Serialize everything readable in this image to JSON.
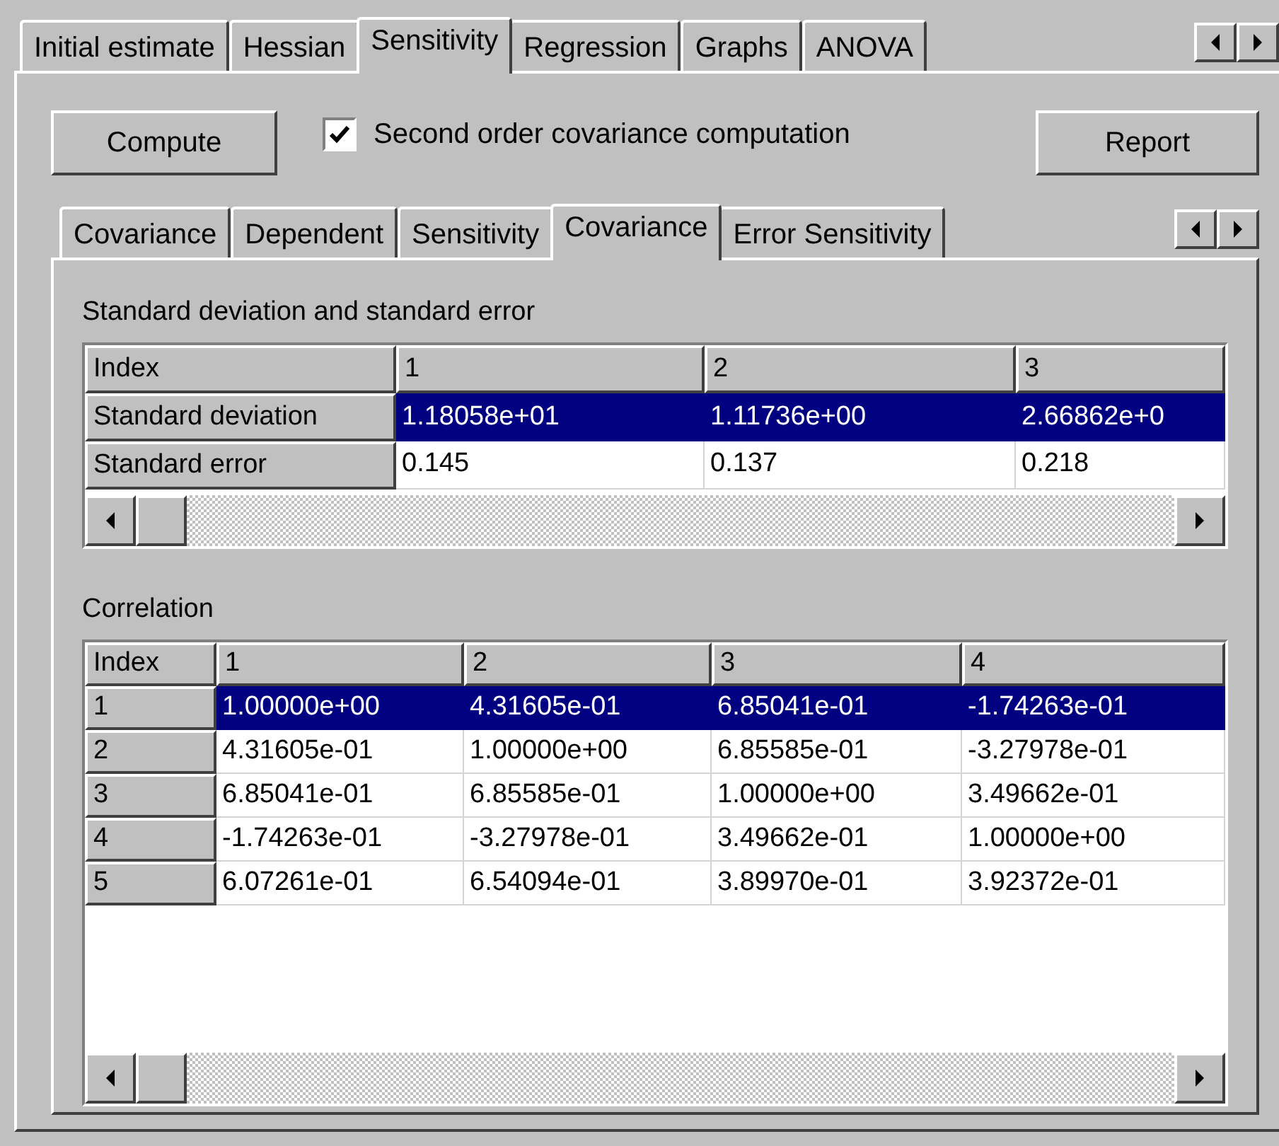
{
  "outer_tabs": [
    {
      "label": "Initial estimate",
      "selected": false
    },
    {
      "label": "Hessian",
      "selected": false
    },
    {
      "label": "Sensitivity",
      "selected": true
    },
    {
      "label": "Regression",
      "selected": false
    },
    {
      "label": "Graphs",
      "selected": false
    },
    {
      "label": "ANOVA",
      "selected": false
    }
  ],
  "compute_button": "Compute",
  "second_order": {
    "label": "Second order covariance computation",
    "checked": true
  },
  "report_button": "Report",
  "inner_tabs": [
    {
      "label": "Covariance",
      "selected": false
    },
    {
      "label": "Dependent",
      "selected": false
    },
    {
      "label": "Sensitivity",
      "selected": false
    },
    {
      "label": "Covariance",
      "selected": true
    },
    {
      "label": "Error Sensitivity",
      "selected": false
    }
  ],
  "std_table": {
    "title": "Standard deviation and standard error",
    "columns": [
      "Index",
      "1",
      "2",
      "3"
    ],
    "rows": [
      {
        "cells": [
          "Standard deviation",
          "1.18058e+01",
          "1.11736e+00",
          "2.66862e+0"
        ],
        "selected": true
      },
      {
        "cells": [
          "Standard error",
          "0.145",
          "0.137",
          "0.218"
        ],
        "selected": false
      }
    ]
  },
  "correlation_table": {
    "title": "Correlation",
    "columns": [
      "Index",
      "1",
      "2",
      "3",
      "4"
    ],
    "rows": [
      {
        "cells": [
          "1",
          "1.00000e+00",
          "4.31605e-01",
          "6.85041e-01",
          "-1.74263e-01"
        ],
        "selected": true
      },
      {
        "cells": [
          "2",
          "4.31605e-01",
          "1.00000e+00",
          "6.85585e-01",
          "-3.27978e-01"
        ],
        "selected": false
      },
      {
        "cells": [
          "3",
          "6.85041e-01",
          "6.85585e-01",
          "1.00000e+00",
          "3.49662e-01"
        ],
        "selected": false
      },
      {
        "cells": [
          "4",
          "-1.74263e-01",
          "-3.27978e-01",
          "3.49662e-01",
          "1.00000e+00"
        ],
        "selected": false
      },
      {
        "cells": [
          "5",
          "6.07261e-01",
          "6.54094e-01",
          "3.89970e-01",
          "3.92372e-01"
        ],
        "selected": false
      }
    ]
  }
}
